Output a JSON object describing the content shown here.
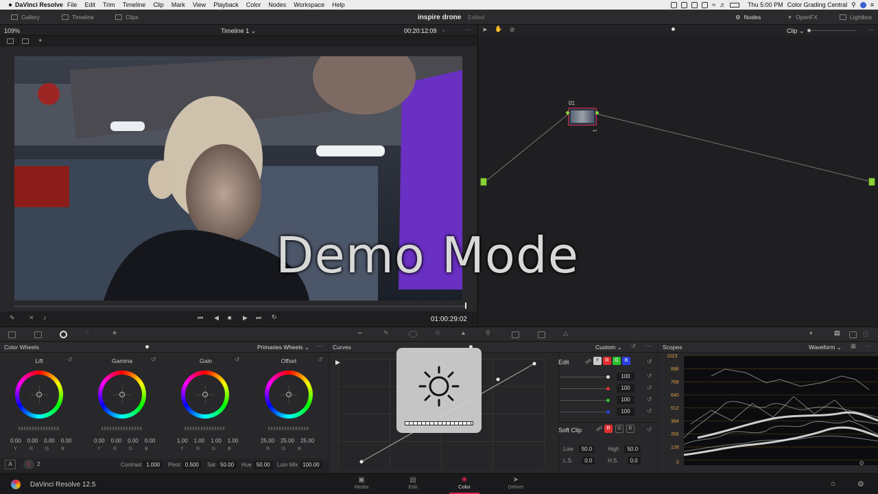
{
  "menubar": {
    "app": "DaVinci Resolve",
    "items": [
      "File",
      "Edit",
      "Trim",
      "Timeline",
      "Clip",
      "Mark",
      "View",
      "Playback",
      "Color",
      "Nodes",
      "Workspace",
      "Help"
    ],
    "clock": "Thu 5:00 PM",
    "user": "Color Grading Central"
  },
  "topbar": {
    "gallery": "Gallery",
    "timeline": "Timeline",
    "clips": "Clips",
    "project": "inspire drone",
    "status": "Edited",
    "nodes": "Nodes",
    "openfx": "OpenFX",
    "lightbox": "Lightbox"
  },
  "viewer": {
    "zoom": "109%",
    "timeline_name": "Timeline 1",
    "source_tc": "00:20:12:09",
    "record_tc": "01:00:29:02"
  },
  "nodes": {
    "mode": "Clip",
    "node_label": "01"
  },
  "color_wheels": {
    "title": "Color Wheels",
    "mode": "Primaries Wheels",
    "wheels": [
      {
        "label": "Lift",
        "values": [
          "0.00",
          "0.00",
          "0.00",
          "0.00"
        ],
        "channels": [
          "Y",
          "R",
          "G",
          "B"
        ]
      },
      {
        "label": "Gamma",
        "values": [
          "0.00",
          "0.00",
          "0.00",
          "0.00"
        ],
        "channels": [
          "Y",
          "R",
          "G",
          "B"
        ]
      },
      {
        "label": "Gain",
        "values": [
          "1.00",
          "1.00",
          "1.00",
          "1.00"
        ],
        "channels": [
          "Y",
          "R",
          "G",
          "B"
        ]
      },
      {
        "label": "Offset",
        "values": [
          "25.00",
          "25.00",
          "25.00"
        ],
        "channels": [
          "R",
          "G",
          "B"
        ]
      }
    ],
    "contrast_label": "Contrast",
    "contrast": "1.000",
    "pivot_label": "Pivot",
    "pivot": "0.500",
    "sat_label": "Sat",
    "sat": "50.00",
    "hue_label": "Hue",
    "hue": "50.00",
    "lummix_label": "Lum Mix",
    "lummix": "100.00",
    "page_a": "A",
    "page1": "1",
    "page2": "2"
  },
  "curves": {
    "title": "Curves",
    "mode": "Custom",
    "edit_label": "Edit",
    "channels": [
      "Y",
      "R",
      "G",
      "B"
    ],
    "intensities": [
      "100",
      "100",
      "100",
      "100"
    ],
    "soft_clip": "Soft Clip",
    "sc_channels": [
      "R",
      "G",
      "B"
    ],
    "low_label": "Low",
    "low": "50.0",
    "high_label": "High",
    "high": "50.0",
    "ls_label": "L.S.",
    "ls": "0.0",
    "hs_label": "H.S.",
    "hs": "0.0"
  },
  "scopes": {
    "title": "Scopes",
    "mode": "Waveform",
    "ticks": [
      "1023",
      "896",
      "768",
      "640",
      "512",
      "384",
      "256",
      "128",
      "0"
    ]
  },
  "demo_text": "Demo Mode",
  "bottom": {
    "app_version": "DaVinci Resolve 12.5",
    "pages": [
      "Media",
      "Edit",
      "Color",
      "Deliver"
    ]
  },
  "colors": {
    "accent": "#e0244a",
    "node_green": "#8bd13a",
    "panel": "#28282b"
  }
}
